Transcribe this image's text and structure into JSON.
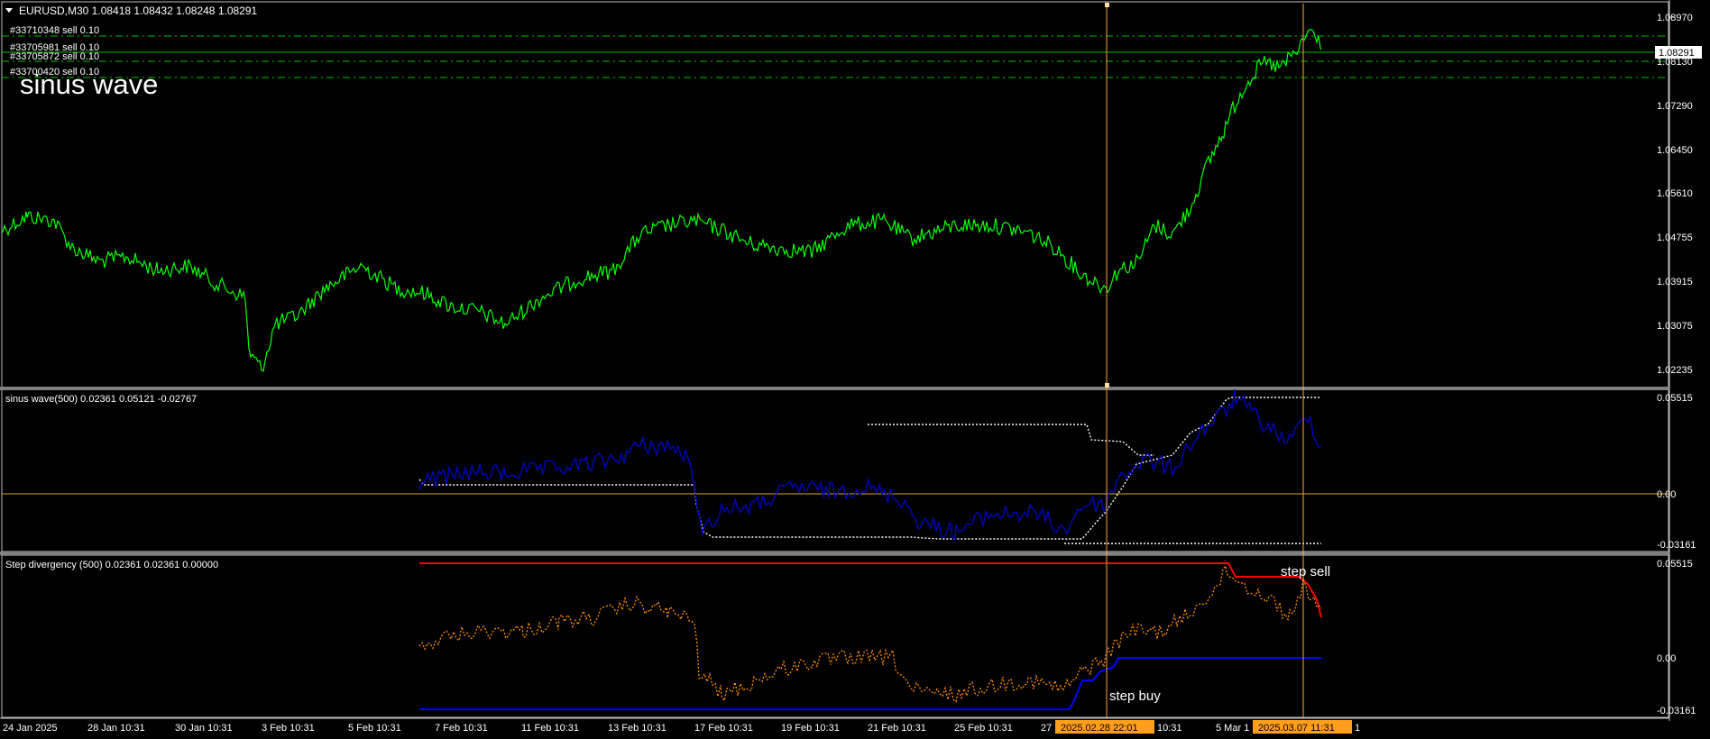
{
  "main": {
    "header": "EURUSD,M30  1.08418 1.08432 1.08248 1.08291",
    "title": "sinus wave",
    "orders": [
      "#33710348 sell 0.10",
      "#33705981 sell 0.10",
      "#33705872 sell 0.10",
      "#33700420 sell 0.10"
    ],
    "price_labels": [
      "1.08970",
      "1.08130",
      "1.07290",
      "1.06450",
      "1.05610",
      "1.04755",
      "1.03915",
      "1.03075",
      "1.02235"
    ],
    "current_price": "1.08291"
  },
  "sub1": {
    "title": "sinus wave(500) 0.02361 0.05121 -0.02767",
    "scale": [
      "0.05515",
      "0.00",
      "-0.03161"
    ]
  },
  "sub2": {
    "title": "Step divergency (500) 0.02361 0.02361 0.00000",
    "scale": [
      "0.05515",
      "0.00",
      "-0.03161"
    ],
    "label_sell": "step sell",
    "label_buy": "step buy"
  },
  "time_axis": {
    "labels": [
      "24 Jan 2025",
      "28 Jan 10:31",
      "30 Jan 10:31",
      "3 Feb 10:31",
      "5 Feb 10:31",
      "7 Feb 10:31",
      "11 Feb 10:31",
      "13 Feb 10:31",
      "17 Feb 10:31",
      "19 Feb 10:31",
      "21 Feb 10:31",
      "25 Feb 10:31",
      "27",
      "10:31",
      "5 Mar 1",
      "1"
    ],
    "marker1": "2025.02.28 22:01",
    "marker2": "2025.03.07 11:31"
  },
  "colors": {
    "price": "#00ff00",
    "sinus": "#0000cc",
    "dotted": "#ffffff",
    "step_dotted": "#ff8c00",
    "step_top": "#ff0000",
    "step_bottom": "#0000ff",
    "zero": "#daa520",
    "cursor": "#ffa040",
    "grid": "#00c000"
  }
}
